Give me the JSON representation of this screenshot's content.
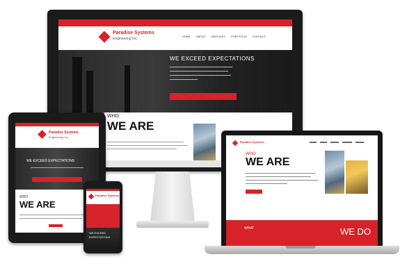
{
  "brand": {
    "company_name": "Paradise Systems",
    "company_sub": "Engineering Inc.",
    "accent_color": "#d72229",
    "frame_color": "#1b1b1b"
  },
  "monitor": {
    "nav_items": [
      "HOME",
      "ABOUT",
      "SERVICES",
      "PORTFOLIO",
      "CONTACT"
    ],
    "hero_heading": "WE EXCEED EXPECTATIONS",
    "who_small": "WHO",
    "who_big": "WE ARE"
  },
  "tablet": {
    "hero_heading": "WE EXCEED EXPECTATIONS",
    "who_small": "WHO",
    "who_big": "WE ARE"
  },
  "phone": {
    "hero_line1": "WE EXCEED",
    "hero_line2": "EXPECTATIONS"
  },
  "laptop": {
    "who_small": "WHO",
    "who_big": "WE ARE",
    "what_small": "WHAT",
    "what_big": "WE DO"
  },
  "icons": [
    "logo-cube-icon"
  ]
}
